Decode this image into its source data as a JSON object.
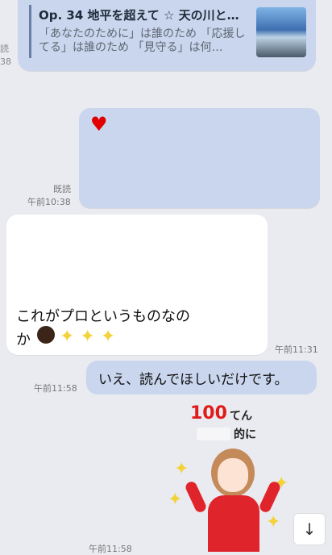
{
  "link_preview": {
    "title": "Op. 34 地平を超えて ☆ 天の川と…",
    "description": "「あなたのために」は誰のため 「応援してる」は誰のため 「見守る」は何…",
    "stub_time": "38"
  },
  "stub": {
    "time_top": "読",
    "time_bottom": "38"
  },
  "heart_message": {
    "emoji": "♥",
    "read_label": "既読",
    "time": "午前10:38"
  },
  "received": {
    "line1": "これがプロというものなの",
    "line2_prefix": "か",
    "sparkles": "✦ ✦ ✦",
    "time": "午前11:31"
  },
  "reply": {
    "text": "いえ、読んでほしいだけです。",
    "time": "午前11:58"
  },
  "sticker": {
    "score": "100",
    "score_suffix": "てん",
    "line2": "的に",
    "time": "午前11:58"
  },
  "controls": {
    "scroll_down_icon": "arrow-down-icon"
  }
}
